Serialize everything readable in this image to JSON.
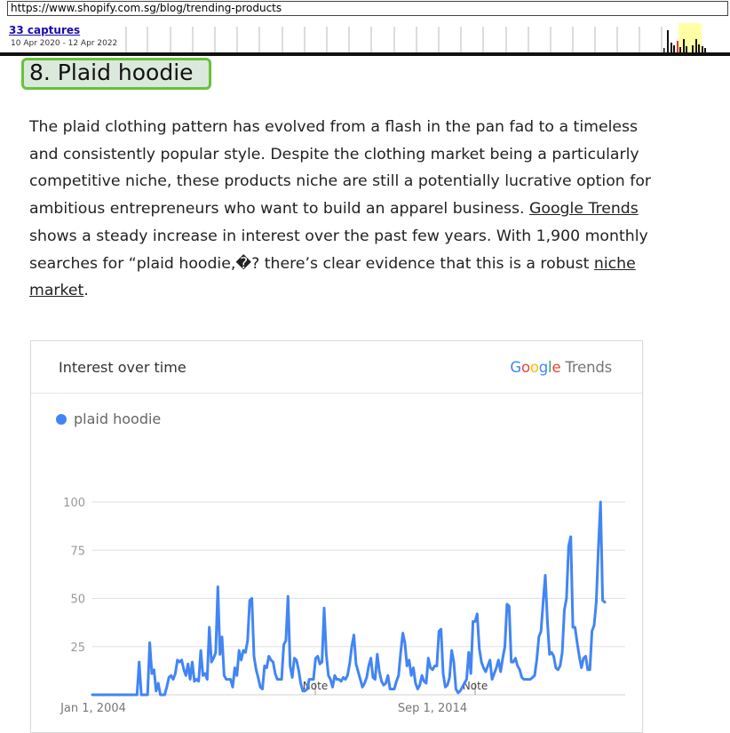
{
  "wayback": {
    "url": "https://www.shopify.com.sg/blog/trending-products",
    "captures_label": "33 captures",
    "date_range": "10 Apr 2020 - 12 Apr 2022"
  },
  "article": {
    "heading": "8. Plaid hoodie",
    "para_1": "The plaid clothing pattern has evolved from a flash in the pan fad to a timeless and consistently popular style. Despite the clothing market being a particularly competitive niche, these products niche are still a potentially lucrative option for ambitious entrepreneurs who want to build an apparel business. ",
    "link_trends": "Google Trends",
    "para_2": " shows a steady increase in interest over the past few years. With 1,900 monthly searches for “plaid hoodie,�? there’s clear evidence that this is a robust ",
    "link_niche": "niche market",
    "para_end": "."
  },
  "trends_card": {
    "title": "Interest over time",
    "brand_google": "Google",
    "brand_trends": " Trends",
    "legend_label": "plaid hoodie",
    "note_labels": [
      "Note",
      "Note"
    ]
  },
  "colors": {
    "series": "#4285f4",
    "highlight_border": "#67c23a",
    "highlight_fill": "#dbe8dc"
  },
  "chart_data": {
    "type": "line",
    "series": [
      {
        "name": "plaid hoodie",
        "values": [
          0,
          0,
          0,
          0,
          0,
          0,
          0,
          0,
          0,
          0,
          0,
          0,
          0,
          0,
          0,
          0,
          0,
          0,
          0,
          0,
          0,
          0,
          17,
          0,
          0,
          0,
          0,
          27,
          11,
          13,
          2,
          6,
          0,
          0,
          0,
          4,
          9,
          10,
          8,
          11,
          18,
          17,
          18,
          13,
          10,
          16,
          8,
          17,
          7,
          8,
          7,
          23,
          10,
          11,
          8,
          35,
          17,
          19,
          22,
          56,
          21,
          30,
          10,
          8,
          8,
          8,
          4,
          14,
          10,
          23,
          18,
          23,
          22,
          28,
          49,
          50,
          20,
          13,
          9,
          4,
          3,
          15,
          14,
          20,
          18,
          17,
          11,
          8,
          8,
          8,
          26,
          28,
          51,
          15,
          9,
          19,
          18,
          13,
          6,
          2,
          2,
          3,
          8,
          8,
          8,
          19,
          20,
          16,
          17,
          45,
          21,
          10,
          8,
          4,
          10,
          8,
          8,
          7,
          9,
          8,
          10,
          16,
          25,
          31,
          16,
          12,
          8,
          4,
          6,
          9,
          15,
          19,
          9,
          8,
          21,
          12,
          7,
          5,
          6,
          10,
          3,
          3,
          3,
          7,
          10,
          22,
          32,
          27,
          15,
          18,
          10,
          14,
          6,
          3,
          5,
          10,
          7,
          6,
          19,
          14,
          13,
          15,
          15,
          33,
          34,
          11,
          4,
          5,
          9,
          23,
          17,
          3,
          1,
          2,
          4,
          6,
          8,
          22,
          11,
          38,
          38,
          42,
          24,
          17,
          14,
          12,
          15,
          18,
          8,
          11,
          14,
          18,
          12,
          19,
          25,
          47,
          46,
          17,
          17,
          19,
          15,
          13,
          9,
          8,
          8,
          8,
          8,
          9,
          10,
          18,
          30,
          33,
          48,
          62,
          38,
          21,
          22,
          20,
          14,
          13,
          15,
          22,
          44,
          50,
          77,
          82,
          35,
          35,
          27,
          20,
          14,
          19,
          20,
          13,
          13,
          33,
          36,
          48,
          76,
          100,
          49,
          48
        ]
      }
    ],
    "x_labels": [
      "Jan 1, 2004",
      "Sep 1, 2014"
    ],
    "y_ticks": [
      25,
      50,
      75,
      100
    ],
    "ylim": [
      0,
      100
    ],
    "grid": true,
    "notes": [
      "Note",
      "Note"
    ]
  }
}
